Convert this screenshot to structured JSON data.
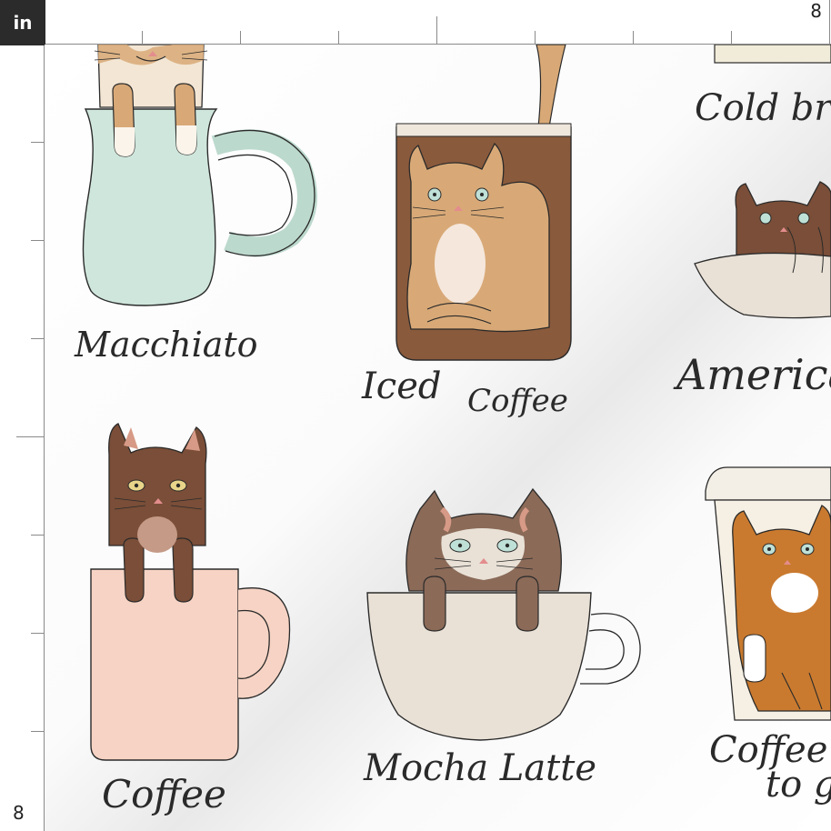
{
  "ruler": {
    "unit": "in",
    "top_end_label": "8",
    "left_end_label": "8"
  },
  "drinks": {
    "macchiato": "Macchiato",
    "iced_coffee_1": "Iced",
    "iced_coffee_2": "Coffee",
    "cold_brew": "Cold brew",
    "americano": "Americano",
    "coffee": "Coffee",
    "mocha_latte": "Mocha Latte",
    "coffee_to_go_1": "Coffee",
    "coffee_to_go_2": "to go"
  },
  "colors": {
    "mint_mug": "#cfe6dc",
    "pink_mug": "#f6d3c4",
    "cream_cup": "#e9e1d6",
    "glass_coffee": "#8a5a3c",
    "tan_cat": "#d8a977",
    "brown_cat": "#7a4e38",
    "orange_cat": "#c97a2f",
    "ink": "#2a2a2a"
  }
}
